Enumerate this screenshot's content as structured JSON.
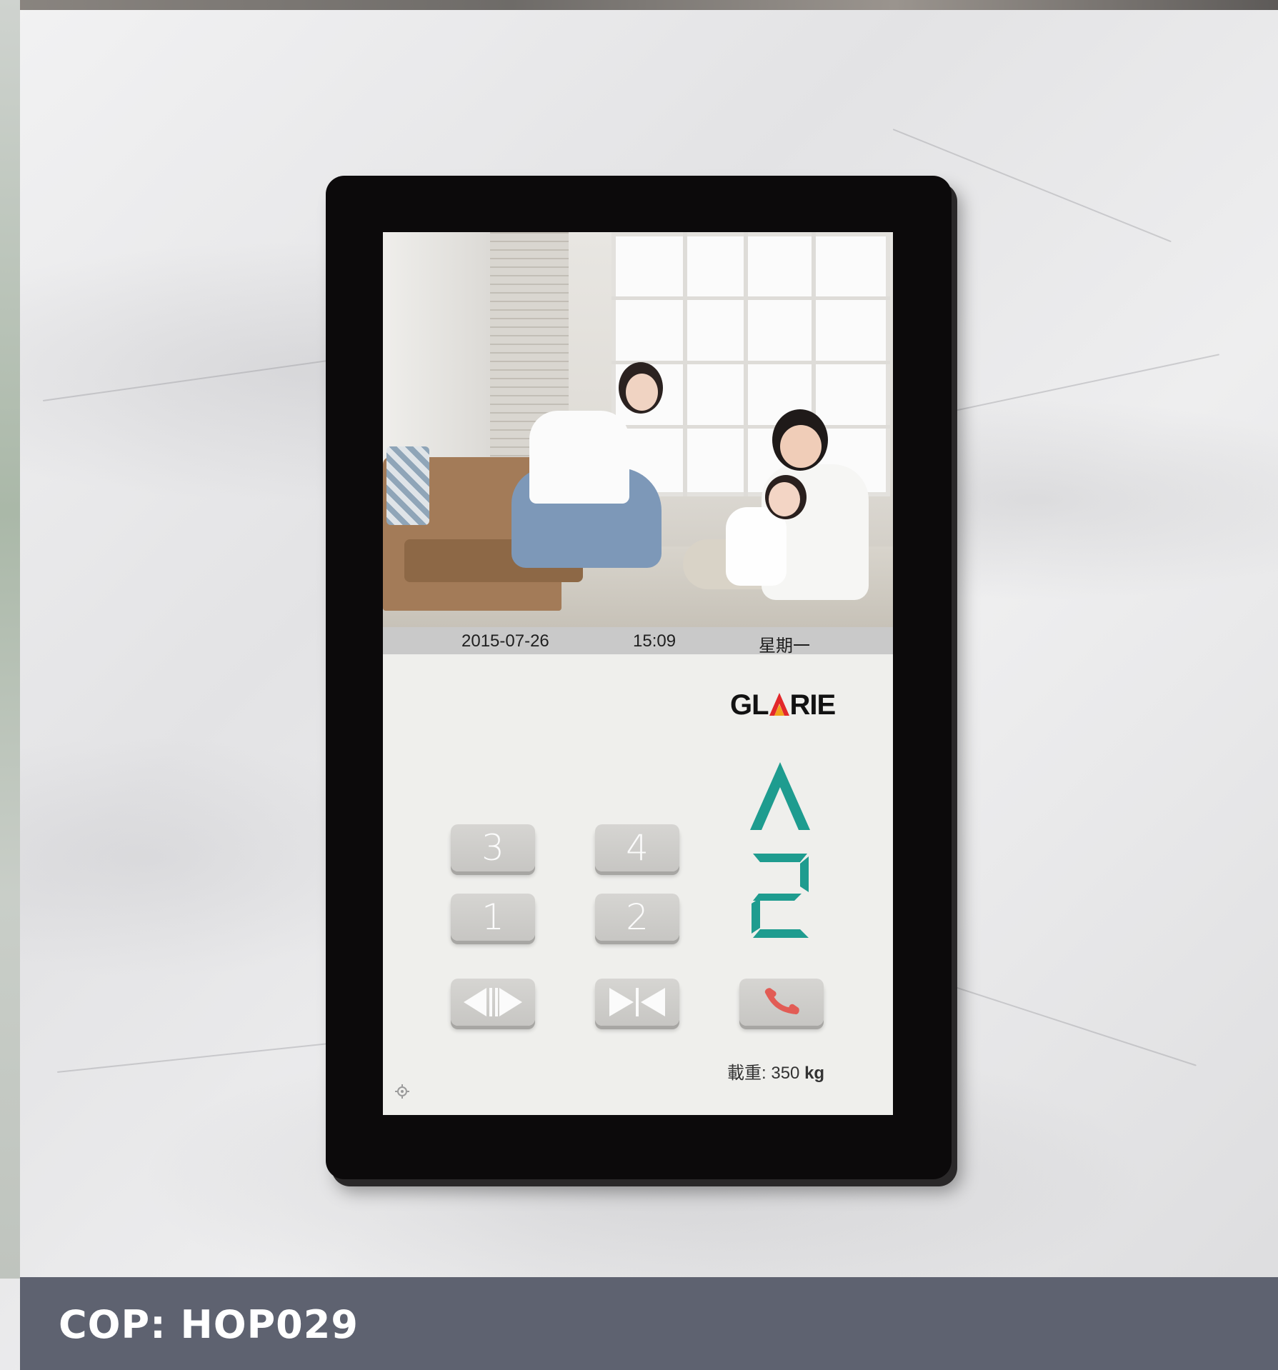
{
  "caption": "COP: HOP029",
  "screen": {
    "date": "2015-07-26",
    "time": "15:09",
    "weekday": "星期一",
    "brand": {
      "left": "GL",
      "right": "RIE",
      "mark_colors": [
        "#e2282a",
        "#f2a21b"
      ]
    },
    "direction": "up",
    "current_floor": "2",
    "floor_buttons": [
      {
        "label": "3"
      },
      {
        "label": "4"
      },
      {
        "label": "1"
      },
      {
        "label": "2"
      }
    ],
    "control_buttons": {
      "door_open_icon": "door-open-icon",
      "door_close_icon": "door-close-icon",
      "alarm_icon": "phone-icon"
    },
    "capacity_label": "載重:",
    "capacity_value": "350",
    "capacity_unit": "kg"
  },
  "colors": {
    "indicator": "#1e9c8f",
    "bezel": "#0c0a0b",
    "screen_bg": "#efefec",
    "button": "#d0cfcc",
    "alarm_icon": "#e25c55",
    "caption_band": "#5e6270"
  }
}
